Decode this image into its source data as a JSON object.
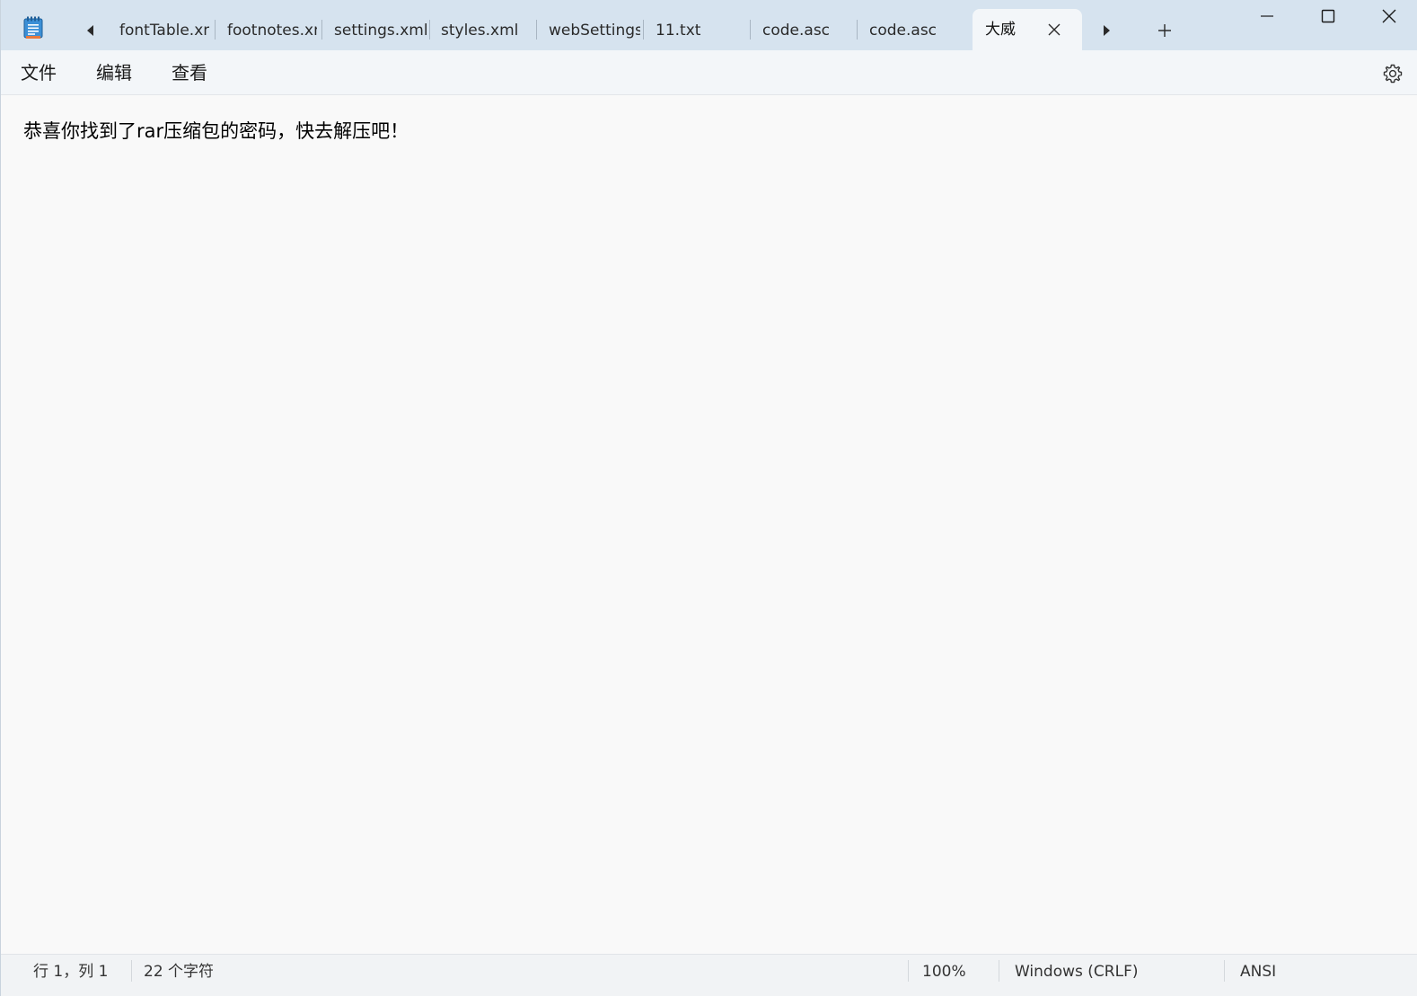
{
  "tabs": [
    {
      "label": "fontTable.xm"
    },
    {
      "label": "footnotes.xn"
    },
    {
      "label": "settings.xml"
    },
    {
      "label": "styles.xml"
    },
    {
      "label": "webSettings"
    },
    {
      "label": "11.txt"
    },
    {
      "label": "code.asc"
    },
    {
      "label": "code.asc"
    }
  ],
  "active_tab": {
    "label": "大威"
  },
  "menu": {
    "file": "文件",
    "edit": "编辑",
    "view": "查看"
  },
  "editor": {
    "content": "恭喜你找到了rar压缩包的密码，快去解压吧！"
  },
  "status": {
    "position": "行 1，列 1",
    "char_count": "22 个字符",
    "zoom": "100%",
    "line_ending": "Windows (CRLF)",
    "encoding": "ANSI"
  },
  "icons": {
    "app": "notepad-icon",
    "scroll_left": "caret-left-icon",
    "scroll_right": "caret-right-icon",
    "new_tab": "plus-icon",
    "tab_close": "close-icon",
    "minimize": "minimize-icon",
    "maximize": "maximize-icon",
    "close_window": "close-icon",
    "settings": "gear-icon"
  },
  "colors": {
    "titlebar": "#d6e3ef",
    "active_tab": "#f3f6f9",
    "editor_bg": "#f9f9f9"
  }
}
